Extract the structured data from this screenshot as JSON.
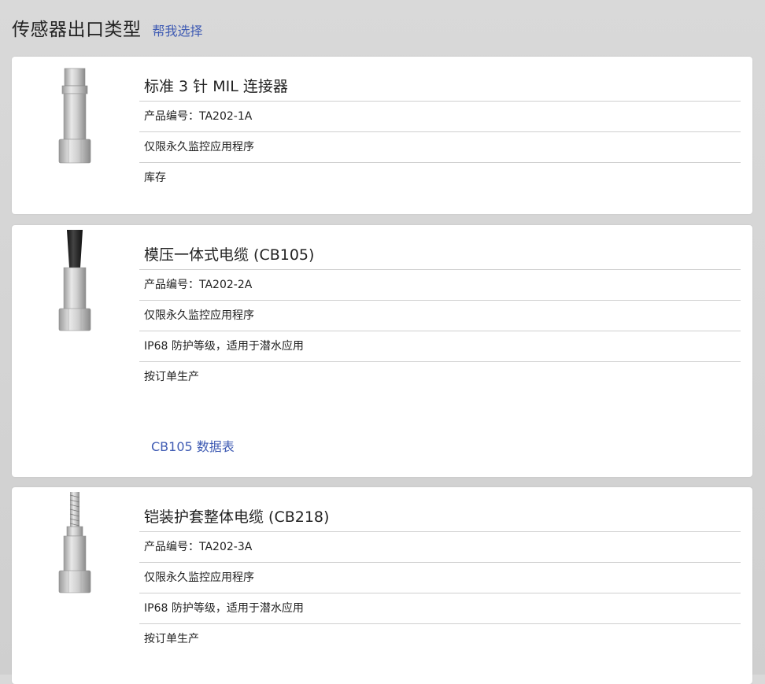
{
  "header": {
    "title": "传感器出口类型",
    "help_link": "帮我选择"
  },
  "products": [
    {
      "title": "标准 3 针 MIL 连接器",
      "specs": [
        "产品编号：TA202-1A",
        "仅限永久监控应用程序",
        "库存"
      ],
      "image": "mil-connector-sensor-image"
    },
    {
      "title": "模压一体式电缆 (CB105)",
      "specs": [
        "产品编号：TA202-2A",
        "仅限永久监控应用程序",
        "IP68 防护等级，适用于潜水应用",
        "按订单生产"
      ],
      "datasheet_link": "CB105 数据表",
      "image": "molded-cable-sensor-image"
    },
    {
      "title": "铠装护套整体电缆 (CB218)",
      "specs": [
        "产品编号：TA202-3A",
        "仅限永久监控应用程序",
        "IP68 防护等级，适用于潜水应用",
        "按订单生产"
      ],
      "image": "armored-cable-sensor-image"
    }
  ],
  "colors": {
    "link": "#3f5bb3",
    "divider": "#cfcfcf",
    "background": "#d4d4d4"
  }
}
